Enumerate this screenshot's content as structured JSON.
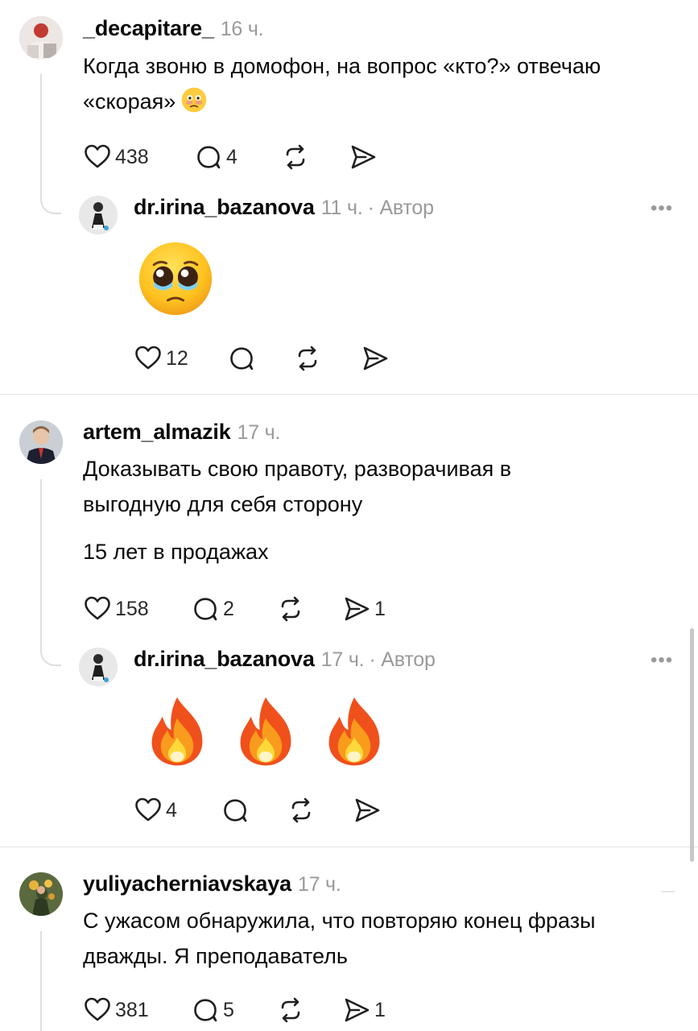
{
  "comments": [
    {
      "username": "_decapitare_",
      "time": "16 ч.",
      "lines": [
        "Когда звоню в домофон, на вопрос «кто?» отвечаю",
        "«скорая»"
      ],
      "inline_emoji": "flushed-pleading-face",
      "likes": "438",
      "replies": "4",
      "shares": "",
      "reply": {
        "username": "dr.irina_bazanova",
        "time": "11 ч.",
        "author_tag": "· Автор",
        "emoji": "pleading-face",
        "likes": "12",
        "replies": "",
        "shares": ""
      }
    },
    {
      "username": "artem_almazik",
      "time": "17 ч.",
      "lines": [
        "Доказывать свою правоту, разворачивая в",
        "выгодную для себя сторону"
      ],
      "extra_line": "15 лет в продажах",
      "likes": "158",
      "replies": "2",
      "shares": "1",
      "reply": {
        "username": "dr.irina_bazanova",
        "time": "17 ч.",
        "author_tag": "· Автор",
        "emoji": "fire x3",
        "likes": "4",
        "replies": "",
        "shares": ""
      }
    },
    {
      "username": "yuliyacherniavskaya",
      "time": "17 ч.",
      "lines": [
        "С ужасом обнаружила, что повторяю конец фразы",
        "дважды. Я преподаватель"
      ],
      "likes": "381",
      "replies": "5",
      "shares": "1"
    }
  ],
  "more_label": "•••",
  "colors": {
    "text": "#0a0a0a",
    "muted": "#9a9a9a",
    "thread_line": "#dedede",
    "divider": "#e3e3e3",
    "icon_stroke": "#1f1f1f"
  }
}
